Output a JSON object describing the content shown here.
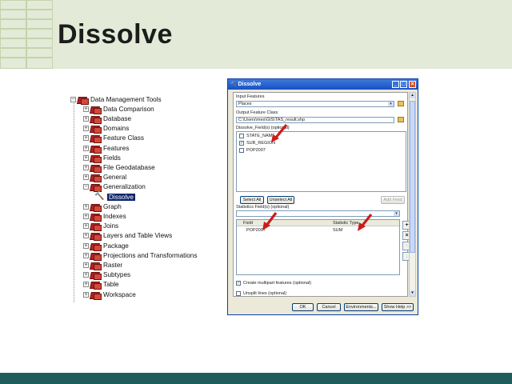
{
  "slide": {
    "title": "Dissolve"
  },
  "tree": {
    "root": "Data Management Tools",
    "items": [
      "Data Comparison",
      "Database",
      "Domains",
      "Feature Class",
      "Features",
      "Fields",
      "File Geodatabase",
      "General",
      "Generalization",
      "Dissolve",
      "Graph",
      "Indexes",
      "Joins",
      "Layers and Table Views",
      "Package",
      "Projections and Transformations",
      "Raster",
      "Subtypes",
      "Table",
      "Workspace"
    ]
  },
  "dialog": {
    "title": "Dissolve",
    "input_label": "Input Features",
    "input_value": "Places",
    "output_label": "Output Feature Class",
    "output_value": "C:\\Users\\mes\\GIS\\TAS_result.shp",
    "dissolve_label": "Dissolve_Field(s) (optional)",
    "fields": [
      {
        "label": "STATE_NAME",
        "checked": false
      },
      {
        "label": "SUB_REGION",
        "checked": true
      },
      {
        "label": "POP2007",
        "checked": false
      }
    ],
    "select_all": "Select All",
    "unselect_all": "Unselect All",
    "add_field": "Add Field",
    "stats_label": "Statistics Field(s) (optional)",
    "stats_col_field": "Field",
    "stats_col_type": "Statistic Type",
    "stats_row_field": "POP2007",
    "stats_row_type": "SUM",
    "multipart_label": "Create multipart features (optional)",
    "unsplit_label": "Unsplit lines (optional)",
    "ok": "OK",
    "cancel": "Cancel",
    "environments": "Environments...",
    "show_help": "Show Help >>"
  },
  "colors": {
    "header": "#e3ead7",
    "footer": "#1f5d5d",
    "titlebar": "#1650c6",
    "arrow": "#cc1b1b"
  }
}
